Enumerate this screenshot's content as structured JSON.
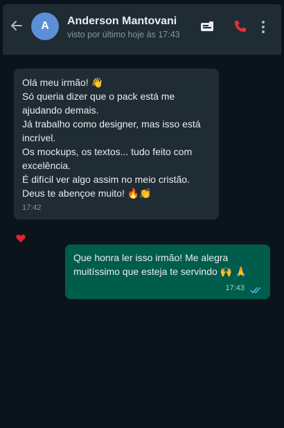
{
  "header": {
    "avatar_initial": "A",
    "contact_name": "Anderson Mantovani",
    "last_seen": "visto por último hoje às 17:43"
  },
  "icons": {
    "back": "arrow-left-icon",
    "video": "video-call-icon",
    "phone": "phone-icon",
    "more": "more-vertical-icon",
    "reaction": "heart-icon",
    "read": "double-check-icon"
  },
  "messages": {
    "incoming": {
      "lines": [
        "Olá meu irmão! 👋",
        "Só queria dizer que o pack está me",
        "ajudando demais.",
        "Já trabalho como designer, mas isso está",
        "incrível.",
        "Os mockups, os textos... tudo feito com",
        "excelência.",
        "É difícil ver algo assim no meio cristão.",
        "Deus te abençoe muito! 🔥👏"
      ],
      "time": "17:42",
      "reaction": "❤️"
    },
    "outgoing": {
      "lines": [
        "Que honra ler isso irmão! Me alegra",
        "muitíssimo que esteja te servindo 🙌 🙏"
      ],
      "time": "17:43"
    }
  },
  "colors": {
    "background": "#0b141a",
    "header": "#1f2c34",
    "incoming_bubble": "#202c33",
    "outgoing_bubble": "#005c4b",
    "read_check": "#53bdeb",
    "call_red": "#e2333a"
  }
}
